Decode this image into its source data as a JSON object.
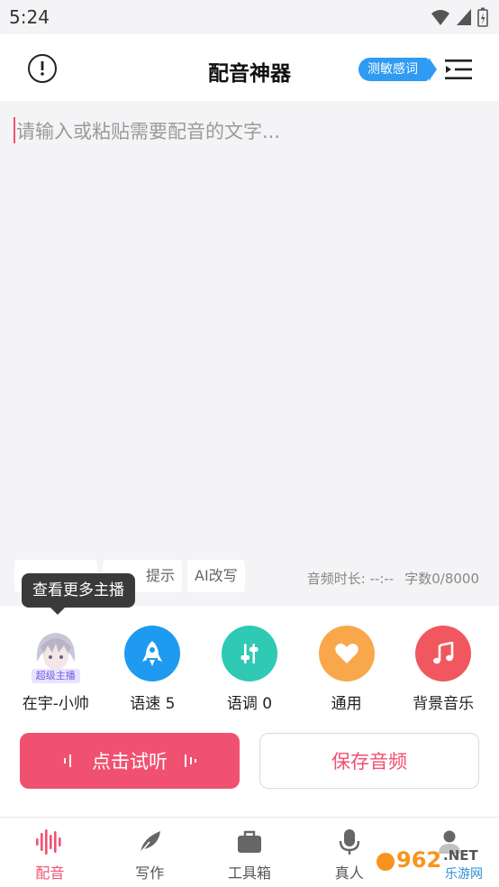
{
  "status_bar": {
    "time": "5:24"
  },
  "app_bar": {
    "title": "配音神器",
    "sensitive_badge": "测敏感词"
  },
  "editor": {
    "placeholder": "请输入或粘贴需要配音的文字..."
  },
  "toolbar_chips": [
    "",
    "",
    "AI改写"
  ],
  "toolbar_chips_visible": {
    "chip2_suffix": "提示"
  },
  "audio_meta": {
    "duration_label": "音频时长: --:--",
    "char_count_label": "字数0/8000"
  },
  "tooltip": {
    "text": "查看更多主播"
  },
  "controls": {
    "voice": {
      "label": "在宇-小帅",
      "badge": "超级主播"
    },
    "speed": {
      "label": "语速 5"
    },
    "tone": {
      "label": "语调 0"
    },
    "style": {
      "label": "通用"
    },
    "bgm": {
      "label": "背景音乐"
    }
  },
  "colors": {
    "accent": "#f05170",
    "speed": "#1e9bf0",
    "tone": "#2fc9b4",
    "style": "#f8a84a",
    "bgm": "#f0575f",
    "badge": "#2f9bf2"
  },
  "actions": {
    "listen_label": "点击试听",
    "save_label": "保存音频"
  },
  "tabs": [
    {
      "label": "配音",
      "icon": "waveform-icon",
      "active": true
    },
    {
      "label": "写作",
      "icon": "feather-icon",
      "active": false
    },
    {
      "label": "工具箱",
      "icon": "toolbox-icon",
      "active": false
    },
    {
      "label": "真人",
      "icon": "microphone-icon",
      "active": false
    },
    {
      "label": "",
      "icon": "person-icon",
      "active": false
    }
  ],
  "watermark": {
    "number": "962",
    "suffix": ".NET",
    "sub": "乐游网"
  }
}
